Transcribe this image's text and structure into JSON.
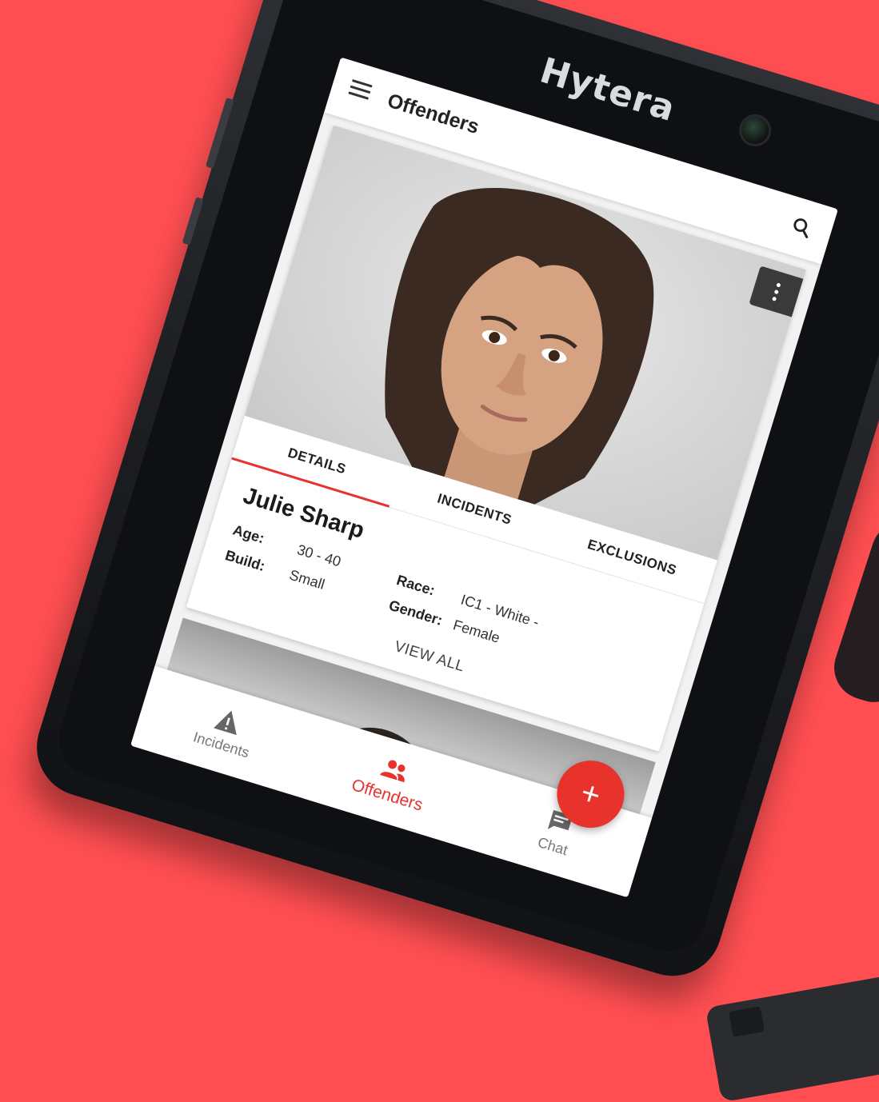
{
  "device": {
    "brand": "Hytera"
  },
  "app_bar": {
    "menu_icon": "menu-icon",
    "title": "Offenders",
    "search_icon": "search-icon"
  },
  "offender_card": {
    "more_icon": "more-vert-icon",
    "tabs": [
      {
        "label": "DETAILS",
        "active": true
      },
      {
        "label": "INCIDENTS",
        "active": false
      },
      {
        "label": "EXCLUSIONS",
        "active": false
      }
    ],
    "name": "Julie Sharp",
    "fields": {
      "age_label": "Age:",
      "age_value": "30 - 40",
      "build_label": "Build:",
      "build_value": "Small",
      "race_label": "Race:",
      "race_value": "IC1 - White -",
      "gender_label": "Gender:",
      "gender_value": "Female"
    },
    "view_all": "VIEW ALL"
  },
  "fab": {
    "label": "+",
    "icon": "add-icon"
  },
  "bottom_nav": {
    "items": [
      {
        "label": "Incidents",
        "icon": "warning-icon",
        "active": false
      },
      {
        "label": "Offenders",
        "icon": "people-icon",
        "active": true
      },
      {
        "label": "Chat",
        "icon": "chat-icon",
        "active": false
      }
    ]
  },
  "colors": {
    "background": "#ff4f52",
    "accent": "#e8322c",
    "device_body": "#1c1d21"
  }
}
